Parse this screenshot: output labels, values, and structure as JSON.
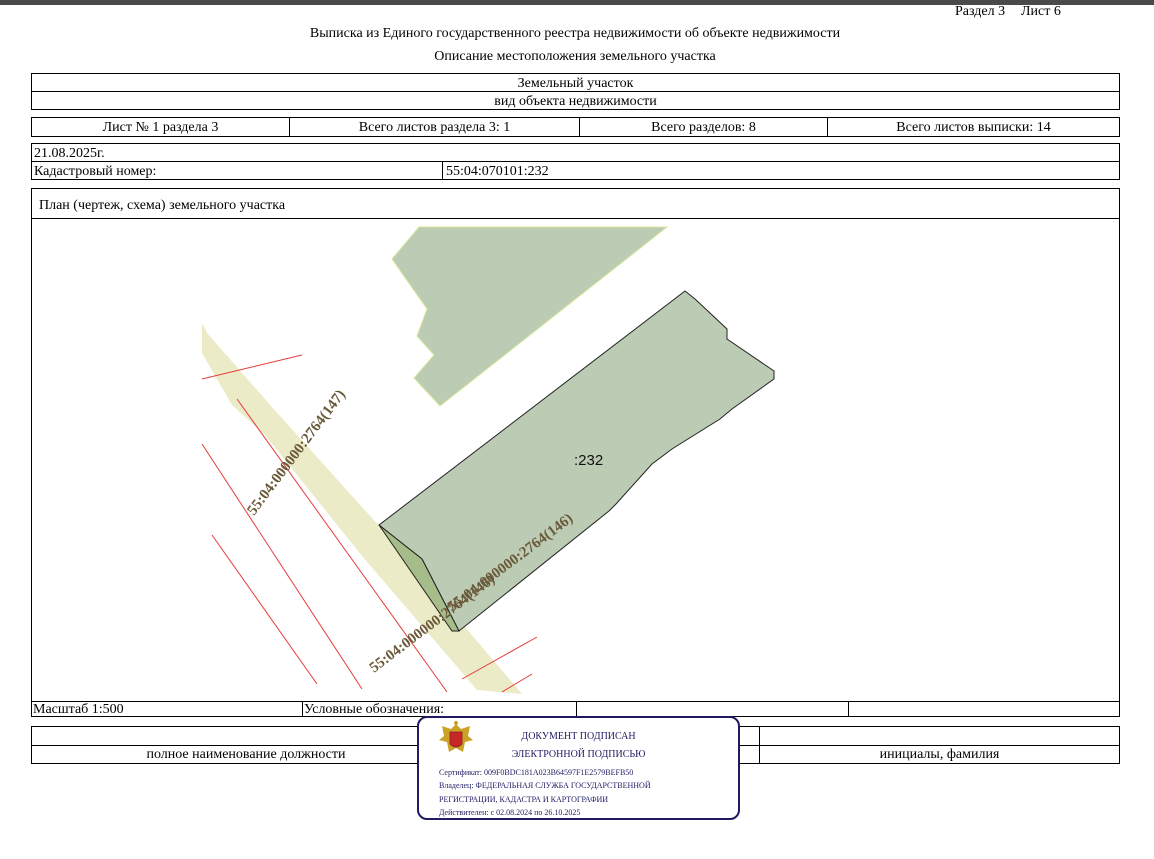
{
  "header": {
    "section_label": "Раздел 3",
    "sheet_label": "Лист 6",
    "title": "Выписка из Единого государственного реестра недвижимости об объекте недвижимости",
    "subtitle": "Описание местоположения земельного участка"
  },
  "object": {
    "type_value": "Земельный участок",
    "type_caption": "вид объекта недвижимости"
  },
  "sheets": {
    "sheet_of_section": "Лист № 1 раздела 3",
    "total_section_sheets": "Всего листов раздела 3: 1",
    "total_sections": "Всего разделов: 8",
    "total_extract_sheets": "Всего листов выписки: 14"
  },
  "date": "21.08.2025г.",
  "cadastral": {
    "label": "Кадастровый номер:",
    "value": "55:04:070101:232"
  },
  "plan": {
    "title": "План (чертеж, схема) земельного участка",
    "parcel_label": ":232",
    "road_label_upper": "55:04:000000:2764(147)",
    "road_label_lower": "55:04:000000:2764(146)",
    "road_label_bottom": "55:04:000000:2764(146)",
    "colors": {
      "parcel_fill": "#bccbb4",
      "road_fill": "#ecebc8",
      "boundary_red": "#e83a3a",
      "label_brown": "#6b5a3a"
    }
  },
  "legend": {
    "scale": "Масштаб 1:500",
    "legend_label": "Условные обозначения:"
  },
  "signature": {
    "position_caption": "полное наименование должности",
    "name_caption": "инициалы, фамилия"
  },
  "stamp": {
    "line1": "ДОКУМЕНТ ПОДПИСАН",
    "line2": "ЭЛЕКТРОННОЙ ПОДПИСЬЮ",
    "certificate": "Сертификат: 009F0BDC181A023B64597F1E2579BEFB50",
    "owner_line1": "Владелец: ФЕДЕРАЛЬНАЯ СЛУЖБА ГОСУДАРСТВЕННОЙ",
    "owner_line2": "РЕГИСТРАЦИИ, КАДАСТРА И КАРТОГРАФИИ",
    "validity": "Действителен: с 02.08.2024 по 26.10.2025",
    "emblem_icon": "coat-of-arms-icon",
    "color": "#1e1b63"
  }
}
